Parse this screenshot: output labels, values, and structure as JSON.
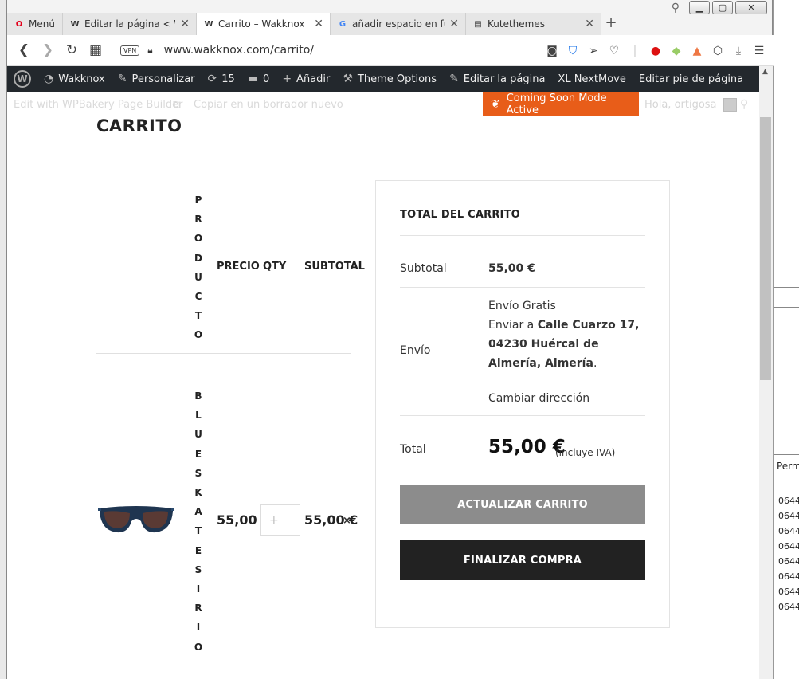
{
  "browser": {
    "tabs": [
      {
        "label": "Menú",
        "icon": "opera-icon"
      },
      {
        "label": "Editar la página < Wakknox",
        "icon": "wakknox-favicon-icon"
      },
      {
        "label": "Carrito – Wakknox",
        "icon": "wakknox-favicon-icon",
        "active": true
      },
      {
        "label": "añadir espacio en función",
        "icon": "google-icon"
      },
      {
        "label": "Kutethemes",
        "icon": "document-icon"
      }
    ],
    "url": "www.wakknox.com/carrito/",
    "vpn_label": "VPN"
  },
  "admin_bar": {
    "site": "Wakknox",
    "customize": "Personalizar",
    "updates": "15",
    "comments": "0",
    "add": "Añadir",
    "theme_options": "Theme Options",
    "edit_page": "Editar la página",
    "xl_nextmove": "XL NextMove",
    "edit_footer": "Editar pie de página"
  },
  "vc_bar": {
    "edit_wpbakery": "Edit with WPBakery Page Builder",
    "copy_draft": "Copiar en un borrador nuevo",
    "coming_soon": "Coming Soon Mode Active",
    "greeting": "Hola, ortigosa"
  },
  "page": {
    "title": "CARRITO"
  },
  "cart": {
    "headers": {
      "product": "PRODUCTO",
      "price": "PRECIO",
      "qty": "QTY",
      "subtotal": "SUBTOTAL"
    },
    "item": {
      "name": "BLUESKATESIRIO",
      "price": "55,00 €",
      "subtotal": "55,00 €",
      "remove": "×"
    }
  },
  "totals": {
    "title": "TOTAL DEL CARRITO",
    "subtotal_label": "Subtotal",
    "subtotal_value": "55,00 €",
    "shipping_label": "Envío",
    "shipping_free": "Envío Gratis",
    "ship_to_prefix": "Enviar a",
    "ship_address": "Calle Cuarzo 17, 04230 Huércal de Almería, Almería",
    "change_address": "Cambiar dirección",
    "total_label": "Total",
    "total_value": "55,00 €",
    "tax_note": "(incluye IVA)",
    "update_button": "ACTUALIZAR CARRITO",
    "checkout_button": "FINALIZAR COMPRA"
  },
  "background_window": {
    "column_header": "Perm",
    "rows": [
      "0644",
      "0644",
      "0644",
      "0644",
      "0644",
      "0644",
      "0644",
      "0644"
    ]
  },
  "colors": {
    "admin_bar": "#23282d",
    "coming_soon": "#e85d19",
    "update_button": "#8c8c8c",
    "checkout_button": "#222222"
  }
}
